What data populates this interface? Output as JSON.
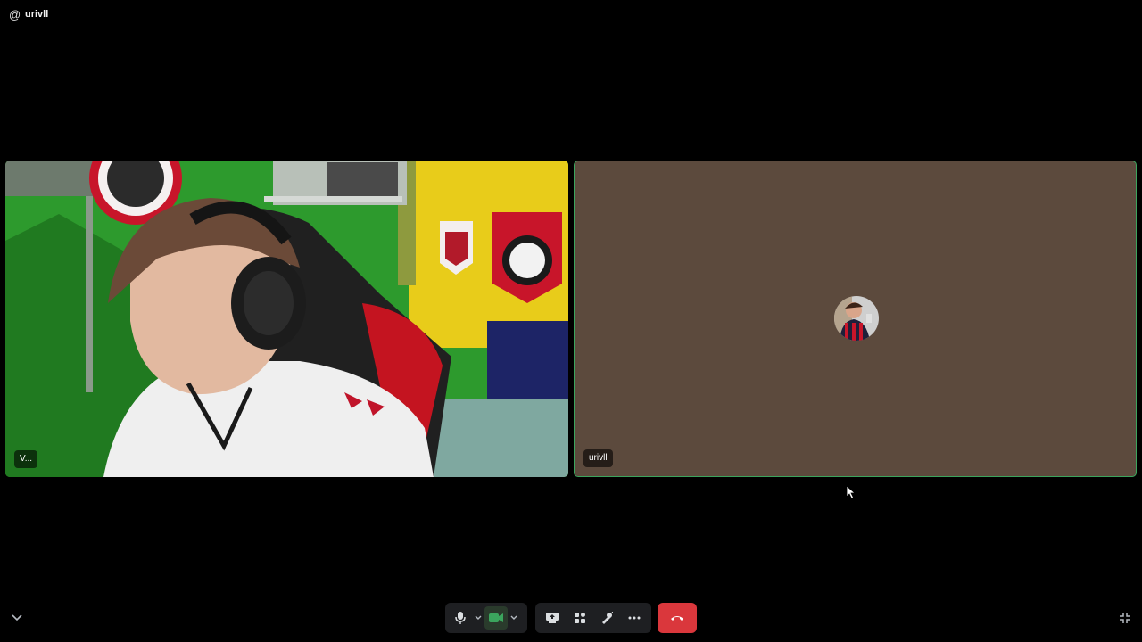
{
  "header": {
    "at_symbol": "@",
    "channel_name": "urivll"
  },
  "tiles": {
    "left": {
      "name_tag": "V..."
    },
    "right": {
      "name_tag": "urivll"
    }
  },
  "controls": {
    "mic": "microphone-icon",
    "mic_options": "chevron-down-icon",
    "camera": "camera-icon",
    "camera_options": "chevron-down-icon",
    "screen_share": "screen-share-icon",
    "activities": "activities-icon",
    "soundboard": "soundboard-icon",
    "more": "more-icon",
    "hangup": "hangup-icon"
  },
  "corner": {
    "collapse": "chevron-down-icon",
    "minimize": "exit-fullscreen-icon"
  },
  "colors": {
    "speaking_border": "#3ba55d",
    "hangup": "#da373c",
    "camera_active": "#3ba55d",
    "tile_bg": "#5c4a3d"
  }
}
